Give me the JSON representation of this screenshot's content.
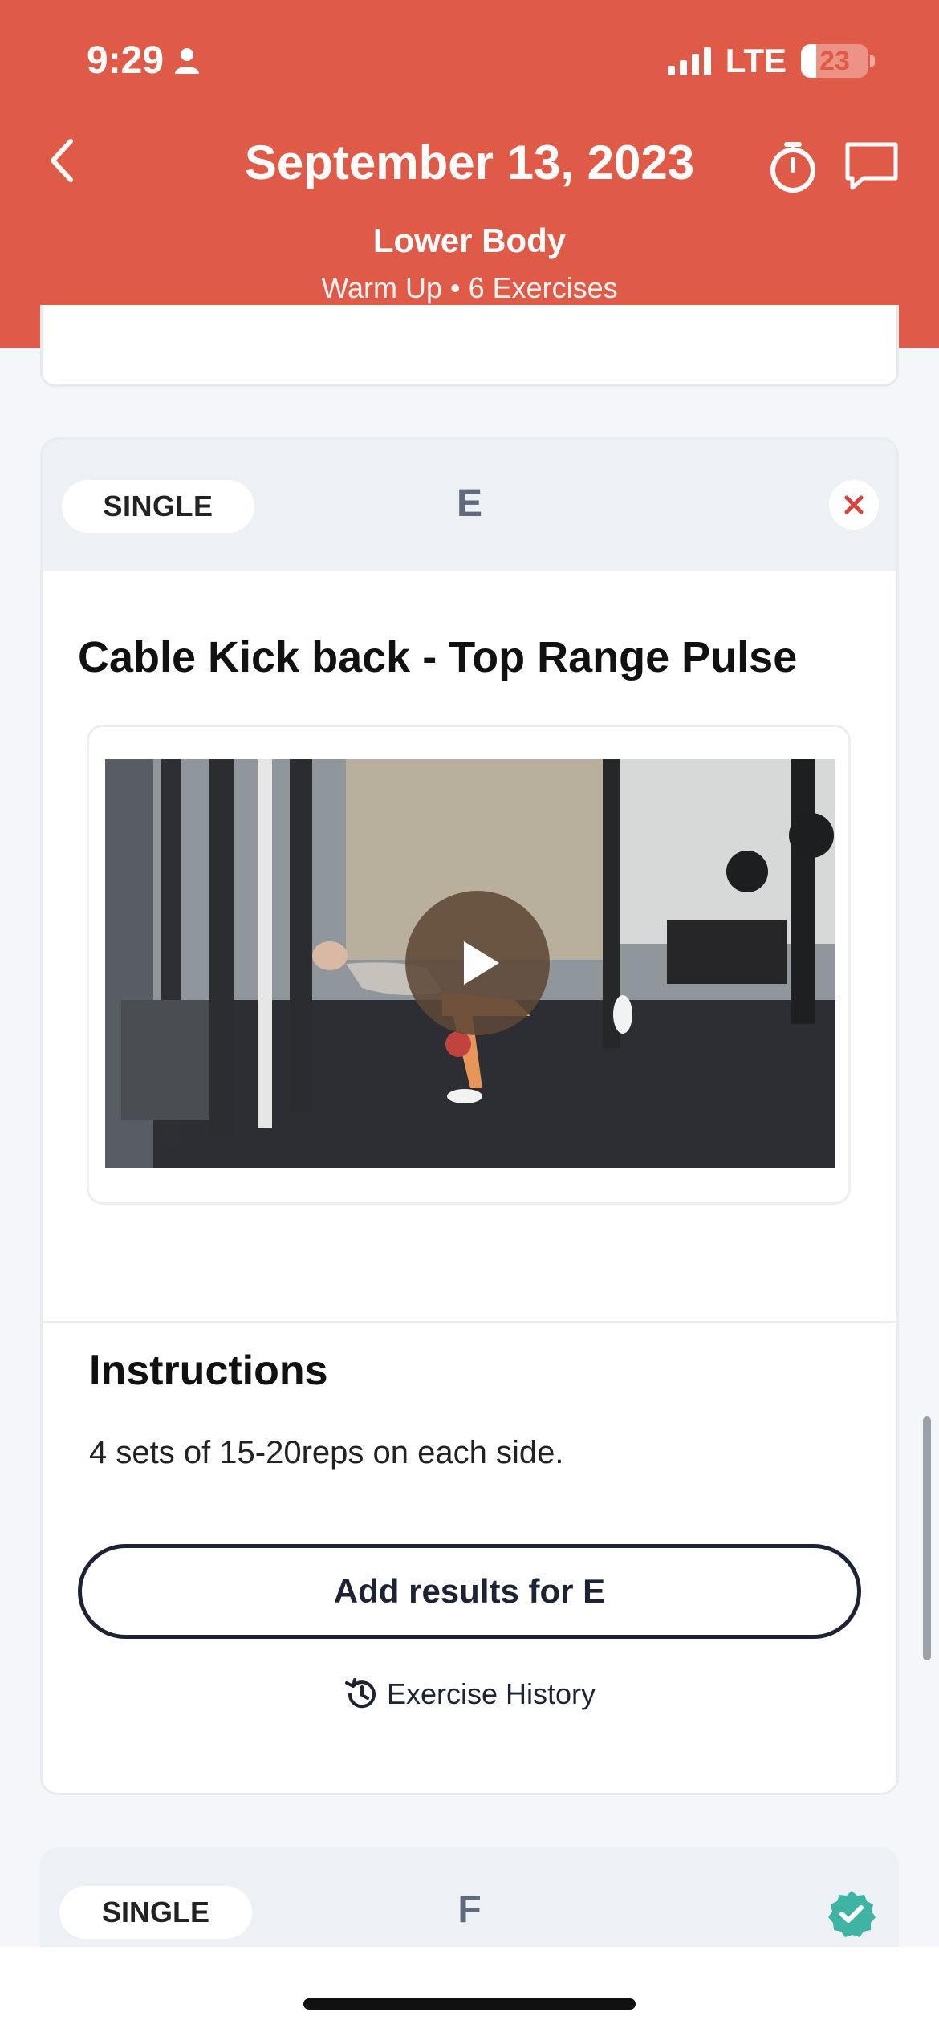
{
  "status_bar": {
    "time": "9:29",
    "network": "LTE",
    "battery": "23",
    "battery_level": 0.23
  },
  "header": {
    "title": "September 13, 2023",
    "workout_name": "Lower Body",
    "subtitle": "Warm Up • 6 Exercises",
    "background_color": "#e05a48"
  },
  "exercise_card": {
    "type_label": "SINGLE",
    "letter": "E",
    "title": "Cable Kick back - Top Range Pulse",
    "instructions_heading": "Instructions",
    "instructions_text": "4 sets of 15-20reps on each side.",
    "add_results_label": "Add results for E",
    "history_label": "Exercise History"
  },
  "next_card": {
    "type_label": "SINGLE",
    "letter": "F",
    "completed": true,
    "badge_color": "#3fb4a5"
  },
  "icons": [
    "person-icon",
    "signal-icon",
    "battery-icon",
    "back-chevron-icon",
    "stopwatch-icon",
    "chat-icon",
    "close-icon",
    "play-icon",
    "history-icon",
    "check-badge-icon"
  ]
}
